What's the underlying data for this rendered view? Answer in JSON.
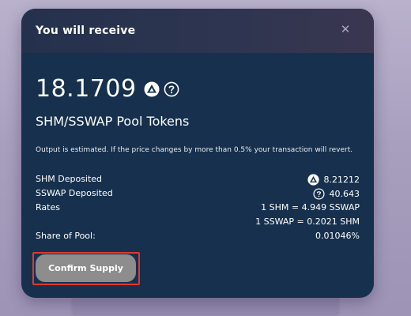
{
  "modal": {
    "title": "You will receive",
    "close_icon": "close-icon",
    "amount": "18.1709",
    "amount_icons": [
      "shm-token-icon",
      "help-icon"
    ],
    "pool_name": "SHM/SSWAP Pool Tokens",
    "notice": "Output is estimated. If the price changes by more than 0.5% your transaction will revert.",
    "rows": {
      "shm_deposited": {
        "label": "SHM Deposited",
        "value": "8.21212",
        "icon": "shm-token-icon"
      },
      "sswap_deposited": {
        "label": "SSWAP Deposited",
        "value": "40.643",
        "icon": "sswap-token-icon"
      },
      "rates": {
        "label": "Rates",
        "value1": "1 SHM = 4.949 SSWAP",
        "value2": "1 SSWAP = 0.2021 SHM"
      },
      "share": {
        "label": "Share of Pool:",
        "value": "0.01046%"
      }
    },
    "confirm_button": "Confirm Supply"
  },
  "colors": {
    "modal_bg": "#16304d",
    "header_bg": "#2e3550",
    "button_bg": "#8c8d8c",
    "highlight_outline": "#e0392f"
  }
}
